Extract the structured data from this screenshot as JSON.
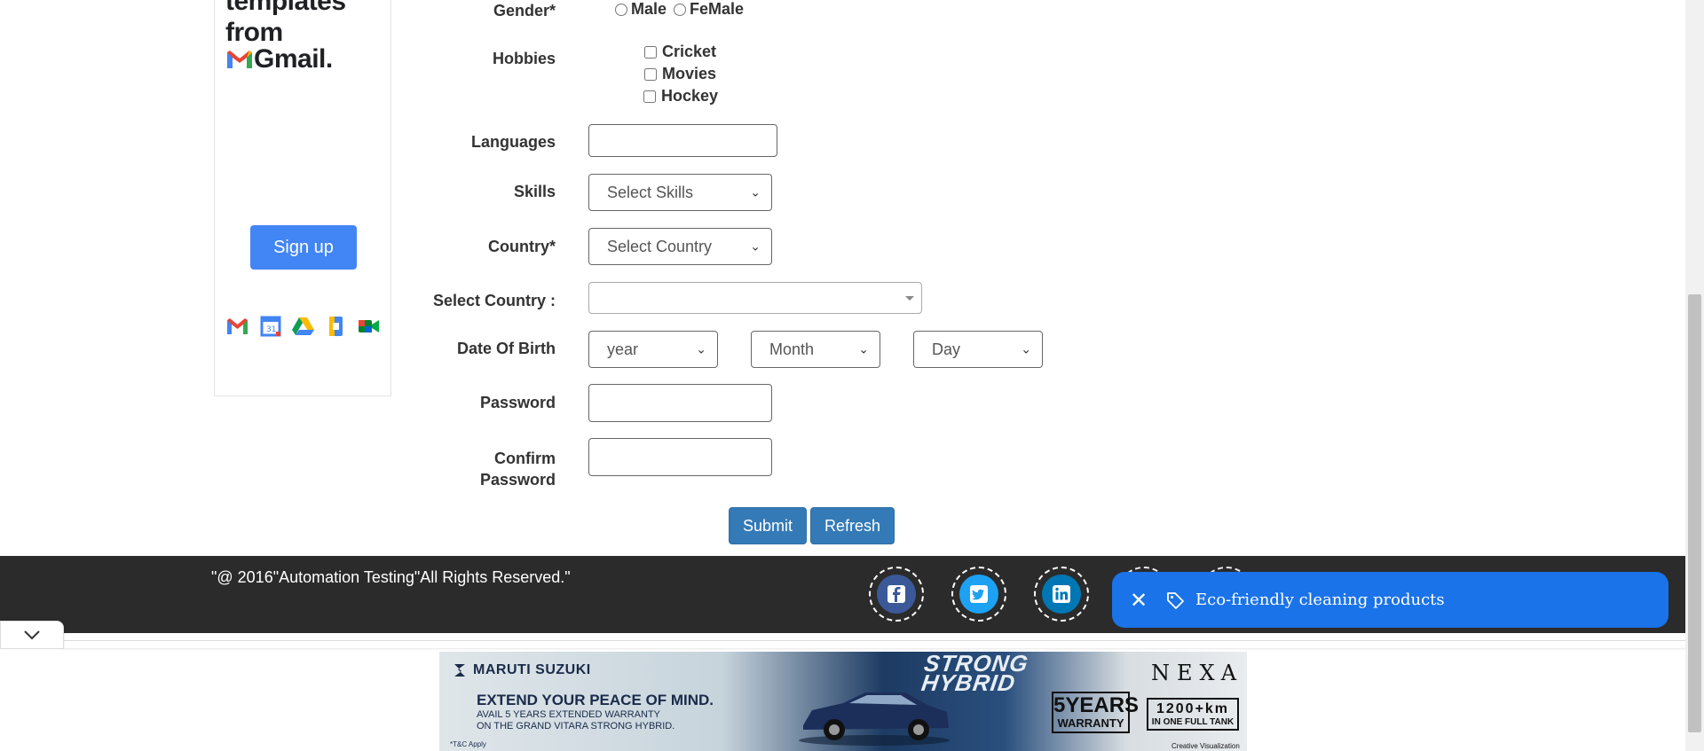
{
  "left_ad": {
    "headline_line1": "templates",
    "headline_line2": "from",
    "brand": "Gmail.",
    "signup_label": "Sign up",
    "apps": [
      "gmail-icon",
      "calendar-icon",
      "drive-icon",
      "docs-icon",
      "meet-icon"
    ]
  },
  "form": {
    "gender": {
      "label": "Gender*",
      "options": [
        "Male",
        "FeMale"
      ]
    },
    "hobbies": {
      "label": "Hobbies",
      "options": [
        "Cricket",
        "Movies",
        "Hockey"
      ]
    },
    "languages": {
      "label": "Languages",
      "value": ""
    },
    "skills": {
      "label": "Skills",
      "selected": "Select Skills"
    },
    "country": {
      "label": "Country*",
      "selected": "Select Country"
    },
    "select_country": {
      "label": "Select Country :",
      "selected": ""
    },
    "dob": {
      "label": "Date Of Birth",
      "year": "year",
      "month": "Month",
      "day": "Day"
    },
    "password": {
      "label": "Password",
      "value": ""
    },
    "confirm_password": {
      "label_line1": "Confirm",
      "label_line2": "Password",
      "value": ""
    },
    "submit_label": "Submit",
    "refresh_label": "Refresh"
  },
  "footer": {
    "copyright": "\"@ 2016\"Automation Testing\"All Rights Reserved.\"",
    "social": [
      "facebook-icon",
      "twitter-icon",
      "linkedin-icon"
    ]
  },
  "toast": {
    "text": "Eco-friendly cleaning products",
    "color": "#1a73e8"
  },
  "banner": {
    "brand": "MARUTI SUZUKI",
    "headline": "EXTEND YOUR PEACE OF MIND.",
    "line2": "AVAIL 5 YEARS EXTENDED WARRANTY",
    "line3": "ON THE GRAND VITARA STRONG HYBRID.",
    "tc": "*T&C Apply",
    "badge": "STRONG HYBRID",
    "nexa": "NEXA",
    "warranty_big": "5YEARS",
    "warranty_small": "WARRANTY",
    "km_big": "1200+km",
    "km_small": "IN ONE FULL TANK",
    "visualization": "Creative Visualization"
  }
}
